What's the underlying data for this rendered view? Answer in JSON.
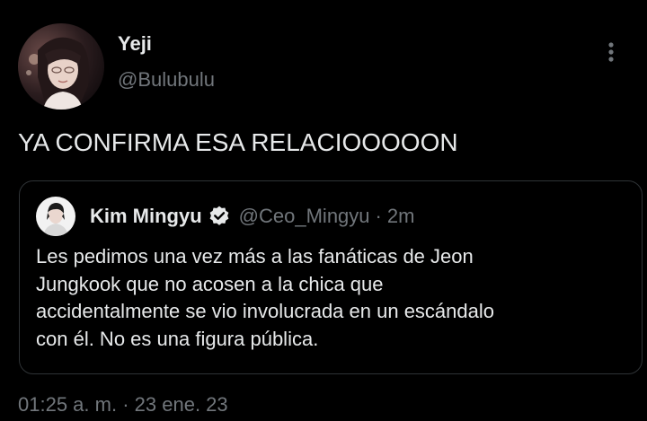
{
  "author": {
    "display_name": "Yeji",
    "handle": "@Bulubulu",
    "avatar_icon": "user-avatar"
  },
  "tweet": {
    "text": "YA CONFIRMA ESA RELACIOOOOON",
    "timestamp_time": "01:25 a. m.",
    "timestamp_sep": "·",
    "timestamp_date": "23 ene. 23"
  },
  "quote": {
    "display_name": "Kim Mingyu",
    "handle": "@Ceo_Mingyu",
    "separator": "·",
    "time": "2m",
    "verified_icon": "verified-badge-icon",
    "lines": [
      "Les pedimos una vez más a las fanáticas de Jeon",
      "Jungkook que no acosen a la chica que",
      "accidentalmente se vio involucrada en un escándalo",
      "con él. No es una figura pública."
    ]
  },
  "more_icon": "more-vertical-icon",
  "colors": {
    "background": "#000000",
    "primary_text": "#e7e9ea",
    "secondary_text": "#71767b",
    "border": "#2f3336"
  }
}
